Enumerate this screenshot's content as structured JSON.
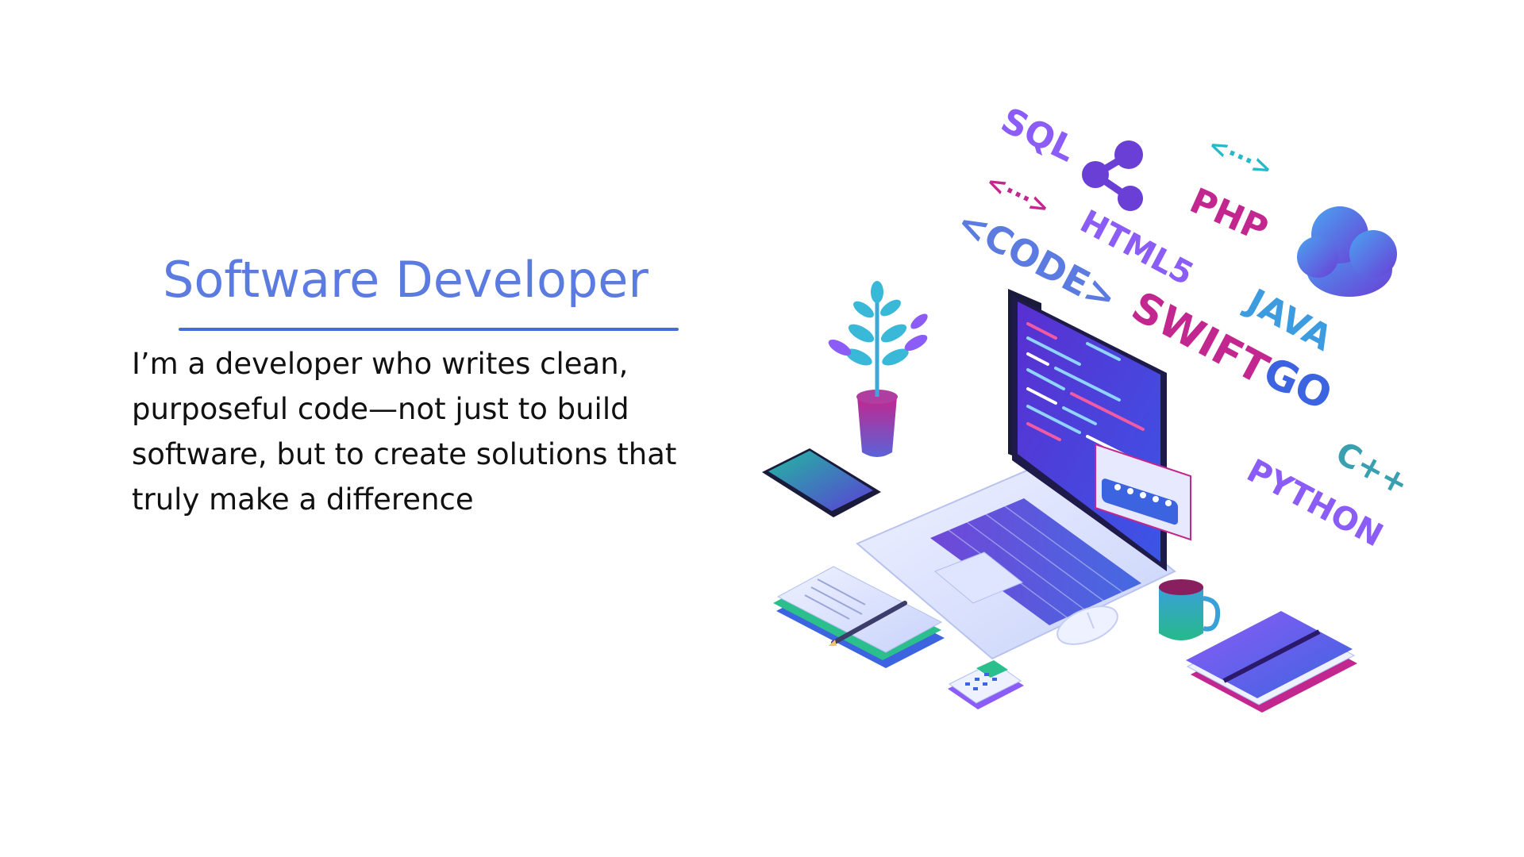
{
  "hero": {
    "title": "Software Developer",
    "description": "I’m a developer who writes clean, purposeful code—not just to build software, but to create solutions that truly make a difference"
  },
  "illustration": {
    "labels": [
      "SQL",
      "<···>",
      "<CODE>",
      "HTML5",
      "PHP",
      "<···>",
      "SWIFT",
      "JAVA",
      "GO",
      "PYTHON",
      "C++"
    ],
    "icons": [
      "share-icon",
      "cloud-icon",
      "laptop",
      "plant",
      "phone",
      "notebook",
      "pencil",
      "calculator",
      "mouse",
      "coffee-mug",
      "book",
      "password-window"
    ],
    "colors": {
      "purple": "#6a3fd6",
      "magenta": "#c2278f",
      "blue": "#3d64e0",
      "teal": "#26b9c9",
      "violet": "#8b5cf6"
    }
  }
}
